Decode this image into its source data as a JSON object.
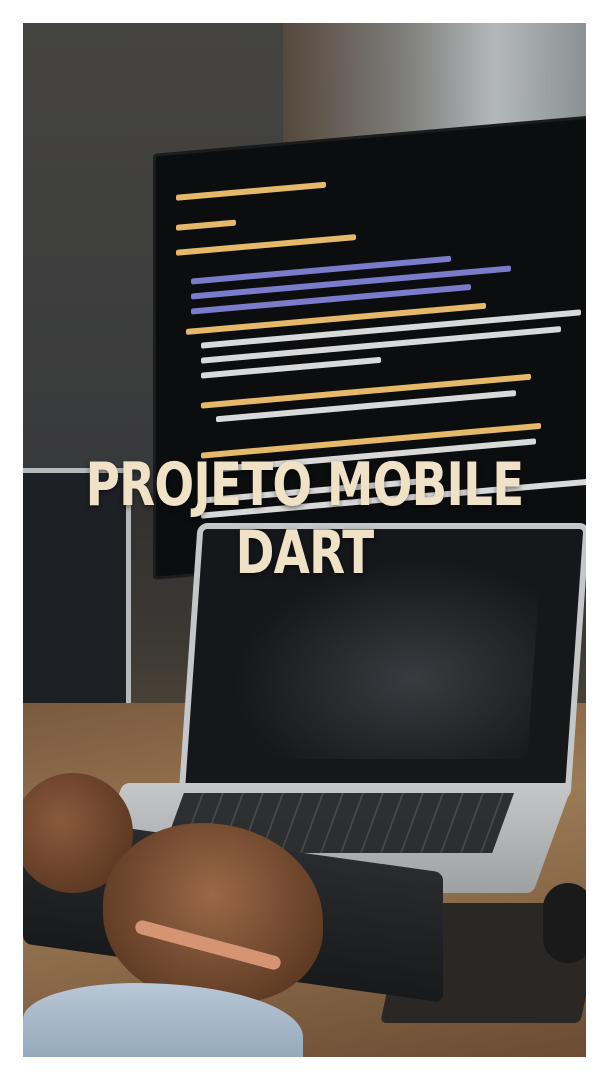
{
  "title": {
    "line1": "PROJETO MOBILE",
    "line2": "DART"
  },
  "photo": {
    "description_icon": "developer-workspace-photo"
  },
  "colors": {
    "title_text": "#efe2c6",
    "page_background": "#ffffff"
  }
}
